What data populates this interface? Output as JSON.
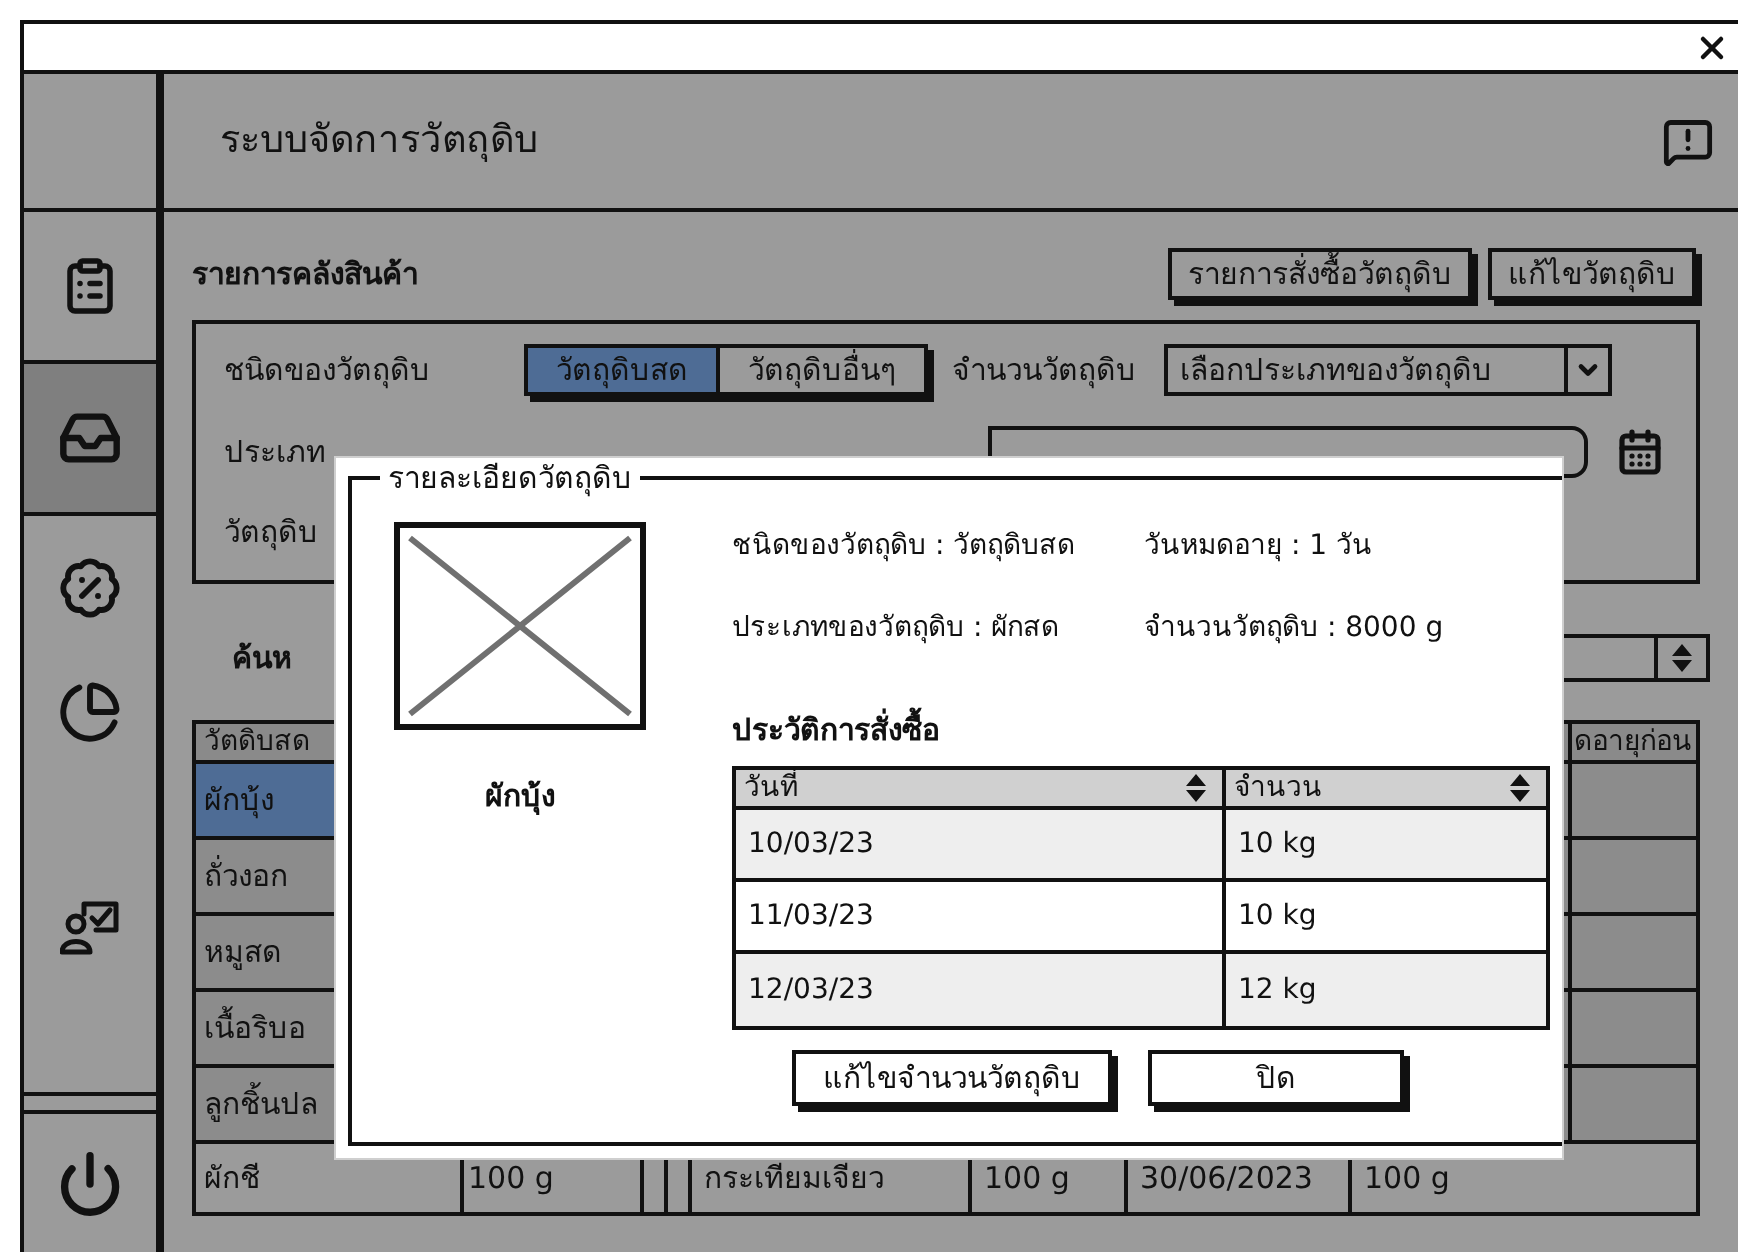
{
  "header": {
    "title": "ระบบจัดการวัตถุดิบ"
  },
  "sidebar": {
    "items": [
      {
        "selected": false
      },
      {
        "selected": true
      },
      {
        "selected": false
      }
    ]
  },
  "inventory": {
    "title": "รายการคลังสินค้า",
    "buttons": [
      "รายการสั่งซื้อวัตถุดิบ",
      "แก้ไขวัตถุดิบ"
    ]
  },
  "filters": {
    "type_label": "ชนิดของวัตถุดิบ",
    "type_options": [
      {
        "label": "วัตถุดิบสด",
        "selected": true
      },
      {
        "label": "วัตถุดิบอื่นๆ",
        "selected": false
      }
    ],
    "amount_label": "จำนวนวัตถุดิบ",
    "amount_select": {
      "value": "เลือกประเภทของวัตถุดิบ"
    },
    "category_label": "ประเภท",
    "material_label": "วัตถุดิบ"
  },
  "search": {
    "label": "ค้นห"
  },
  "table": {
    "header_first": "วัตดิบสด",
    "header_last": "ดอายุก่อน",
    "rows": [
      {
        "left": [
          "ผักบุ้ง"
        ],
        "selected": true
      },
      {
        "left": [
          "ถั่วงอก"
        ],
        "selected": false
      },
      {
        "left": [
          "หมูสด"
        ],
        "selected": false
      },
      {
        "left": [
          "เนื้อริบอ"
        ],
        "selected": false
      },
      {
        "left": [
          "ลูกชิ้นปล"
        ],
        "selected": false
      }
    ],
    "last_row": {
      "left": [
        "ผักชี",
        "100 g"
      ],
      "right": [
        "กระเทียมเจียว",
        "100 g",
        "30/06/2023",
        "100 g"
      ]
    }
  },
  "dialog": {
    "title": "รายละเอียดวัตถุดิบ",
    "name": "ผักบุ้ง",
    "details": [
      "ชนิดของวัตถุดิบ : วัตถุดิบสด",
      "วันหมดอายุ : 1 วัน",
      "ประเภทของวัตถุดิบ : ผักสด",
      "จำนวนวัตถุดิบ : 8000 g"
    ],
    "history_title": "ประวัติการสั่งซื้อ",
    "history": {
      "columns": [
        "วันที่",
        "จำนวน"
      ],
      "rows": [
        [
          "10/03/23",
          "10 kg"
        ],
        [
          "11/03/23",
          "10 kg"
        ],
        [
          "12/03/23",
          "12 kg"
        ]
      ]
    },
    "buttons": [
      "แก้ไขจำนวนวัตถุดิบ",
      "ปิด"
    ]
  }
}
